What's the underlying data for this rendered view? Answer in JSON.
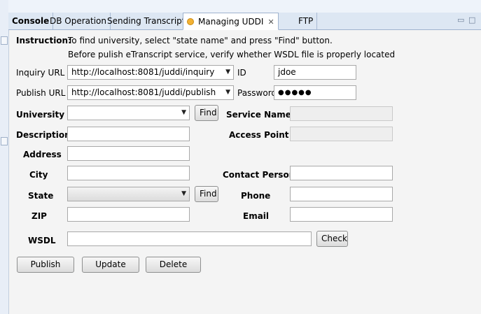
{
  "tabs": [
    {
      "label": "Console"
    },
    {
      "label": "DB Operation"
    },
    {
      "label": "Sending Transcript"
    },
    {
      "label": "Managing UDDI"
    },
    {
      "label": "FTP"
    }
  ],
  "window_controls": {
    "minimize": "▭",
    "maximize": "□"
  },
  "instruction": {
    "label": "Instruction:",
    "line1": "To find university, select \"state name\" and press \"Find\" button.",
    "line2": "Before pulish eTranscript service, verify whether WSDL file is properly located"
  },
  "inquiry": {
    "label": "Inquiry URL",
    "value": "http://localhost:8081/juddi/inquiry"
  },
  "publish_url": {
    "label": "Publish URL",
    "value": "http://localhost:8081/juddi/publish"
  },
  "id": {
    "label": "ID",
    "value": "jdoe"
  },
  "password": {
    "label": "Password",
    "value": "●●●●●"
  },
  "university": {
    "label": "University",
    "value": "",
    "find_label": "Find"
  },
  "description": {
    "label": "Description",
    "value": ""
  },
  "address": {
    "label": "Address",
    "value": ""
  },
  "city": {
    "label": "City",
    "value": ""
  },
  "state": {
    "label": "State",
    "value": "",
    "find_label": "Find"
  },
  "zip": {
    "label": "ZIP",
    "value": ""
  },
  "wsdl": {
    "label": "WSDL",
    "value": "",
    "check_label": "Check"
  },
  "service_name": {
    "label": "Service Name",
    "value": ""
  },
  "access_point": {
    "label": "Access Point",
    "value": ""
  },
  "contact_person": {
    "label": "Contact Person",
    "value": ""
  },
  "phone": {
    "label": "Phone",
    "value": ""
  },
  "email": {
    "label": "Email",
    "value": ""
  },
  "actions": {
    "publish": "Publish",
    "update": "Update",
    "delete": "Delete"
  },
  "icons": {
    "tab_dot": "status-dot-icon",
    "tab_close": "close-icon",
    "dropdown": "chevron-down-icon"
  },
  "colors": {
    "tab_bar": "#dde7f3",
    "panel_bg": "#f4f4f4",
    "active_dot": "#f3b233"
  }
}
